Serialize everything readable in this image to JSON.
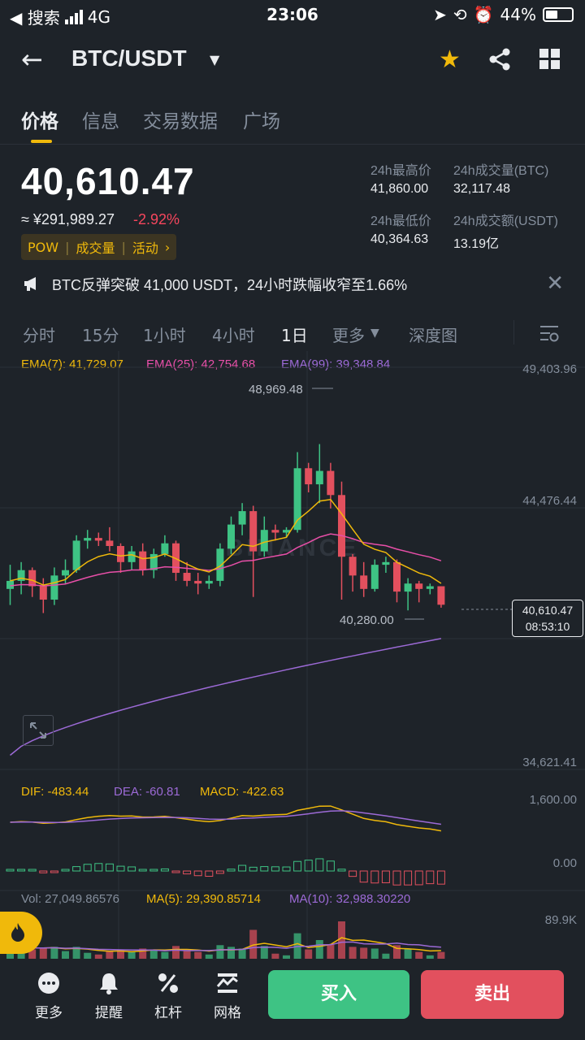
{
  "status_bar": {
    "back_app": "◀ 搜索",
    "network": "4G",
    "time": "23:06",
    "battery": "44%"
  },
  "header": {
    "pair": "BTC/USDT"
  },
  "tabs": [
    {
      "label": "价格"
    },
    {
      "label": "信息"
    },
    {
      "label": "交易数据"
    },
    {
      "label": "广场"
    }
  ],
  "ticker": {
    "price": "40,610.47",
    "cny": "≈ ¥291,989.27",
    "change": "-2.92%",
    "tags": [
      "POW",
      "成交量",
      "活动"
    ],
    "stats": {
      "high_label": "24h最高价",
      "high": "41,860.00",
      "vol_btc_label": "24h成交量(BTC)",
      "vol_btc": "32,117.48",
      "low_label": "24h最低价",
      "low": "40,364.63",
      "vol_usdt_label": "24h成交额(USDT)",
      "vol_usdt": "13.19亿"
    }
  },
  "news": {
    "text": "BTC反弹突破 41,000 USDT，24小时跌幅收窄至1.66%"
  },
  "intervals": [
    "分时",
    "15分",
    "1小时",
    "4小时",
    "1日",
    "更多",
    "深度图"
  ],
  "chart": {
    "ema7": "EMA(7): 41,729.07",
    "ema25": "EMA(25): 42,754.68",
    "ema99": "EMA(99): 39,348.84",
    "axis_top": "49,403.96",
    "axis_mid": "44,476.44",
    "axis_low": "34,621.41",
    "high_marker": "48,969.48",
    "low_marker": "40,280.00",
    "last_price": "40,610.47",
    "countdown": "08:53:10",
    "watermark": "BINANCE",
    "macd_dif": "DIF: -483.44",
    "macd_dea": "DEA: -60.81",
    "macd_macd": "MACD: -422.63",
    "macd_top": "1,600.00",
    "macd_zero": "0.00",
    "vol": "Vol: 27,049.86576",
    "vol_ma5": "MA(5): 29,390.85714",
    "vol_ma10": "MA(10): 32,988.30220",
    "vol_top": "89.9K",
    "colors": {
      "up": "#3ec384",
      "down": "#e2505e",
      "ema7": "#f0b90b",
      "ema25": "#e84fa8",
      "ema99": "#9c6ad6"
    }
  },
  "chart_data": {
    "type": "candlestick",
    "y_axis": [
      34621.41,
      49403.96
    ],
    "candles": [
      [
        41200,
        42100,
        40600,
        41500
      ],
      [
        41500,
        42200,
        41000,
        41900
      ],
      [
        41900,
        42000,
        40900,
        41300
      ],
      [
        41300,
        41600,
        40300,
        40800
      ],
      [
        40800,
        42000,
        40600,
        41700
      ],
      [
        41700,
        42300,
        41400,
        41900
      ],
      [
        41900,
        43200,
        41800,
        43000
      ],
      [
        43000,
        43400,
        42700,
        43100
      ],
      [
        43100,
        43300,
        42800,
        43000
      ],
      [
        43000,
        43500,
        42600,
        42800
      ],
      [
        42800,
        42900,
        41800,
        42200
      ],
      [
        42200,
        42800,
        41900,
        42600
      ],
      [
        42600,
        42900,
        41700,
        41900
      ],
      [
        41900,
        42700,
        41600,
        42500
      ],
      [
        42500,
        43200,
        42400,
        42900
      ],
      [
        42900,
        43000,
        41500,
        41800
      ],
      [
        41800,
        42200,
        41300,
        41500
      ],
      [
        41500,
        41800,
        41000,
        41400
      ],
      [
        41400,
        41700,
        41200,
        41500
      ],
      [
        41500,
        42900,
        41300,
        42700
      ],
      [
        42700,
        43900,
        42500,
        43600
      ],
      [
        43600,
        44400,
        43200,
        44100
      ],
      [
        44100,
        44300,
        40900,
        42600
      ],
      [
        42600,
        43900,
        42400,
        43400
      ],
      [
        43400,
        43600,
        43000,
        43300
      ],
      [
        43300,
        43500,
        43100,
        43400
      ],
      [
        43400,
        46300,
        43300,
        45700
      ],
      [
        45700,
        45900,
        44800,
        45100
      ],
      [
        45100,
        46600,
        44400,
        45600
      ],
      [
        45600,
        45900,
        44200,
        44700
      ],
      [
        44700,
        45200,
        40800,
        42400
      ],
      [
        42400,
        42500,
        41100,
        41700
      ],
      [
        41700,
        42200,
        40900,
        41200
      ],
      [
        41200,
        42300,
        41100,
        42100
      ],
      [
        42100,
        42400,
        41800,
        42200
      ],
      [
        42200,
        42300,
        40700,
        41100
      ],
      [
        41100,
        41600,
        40400,
        41400
      ],
      [
        41400,
        41500,
        40700,
        41200
      ],
      [
        41200,
        41400,
        41000,
        41300
      ],
      [
        41300,
        41300,
        40500,
        40610
      ]
    ]
  }
}
